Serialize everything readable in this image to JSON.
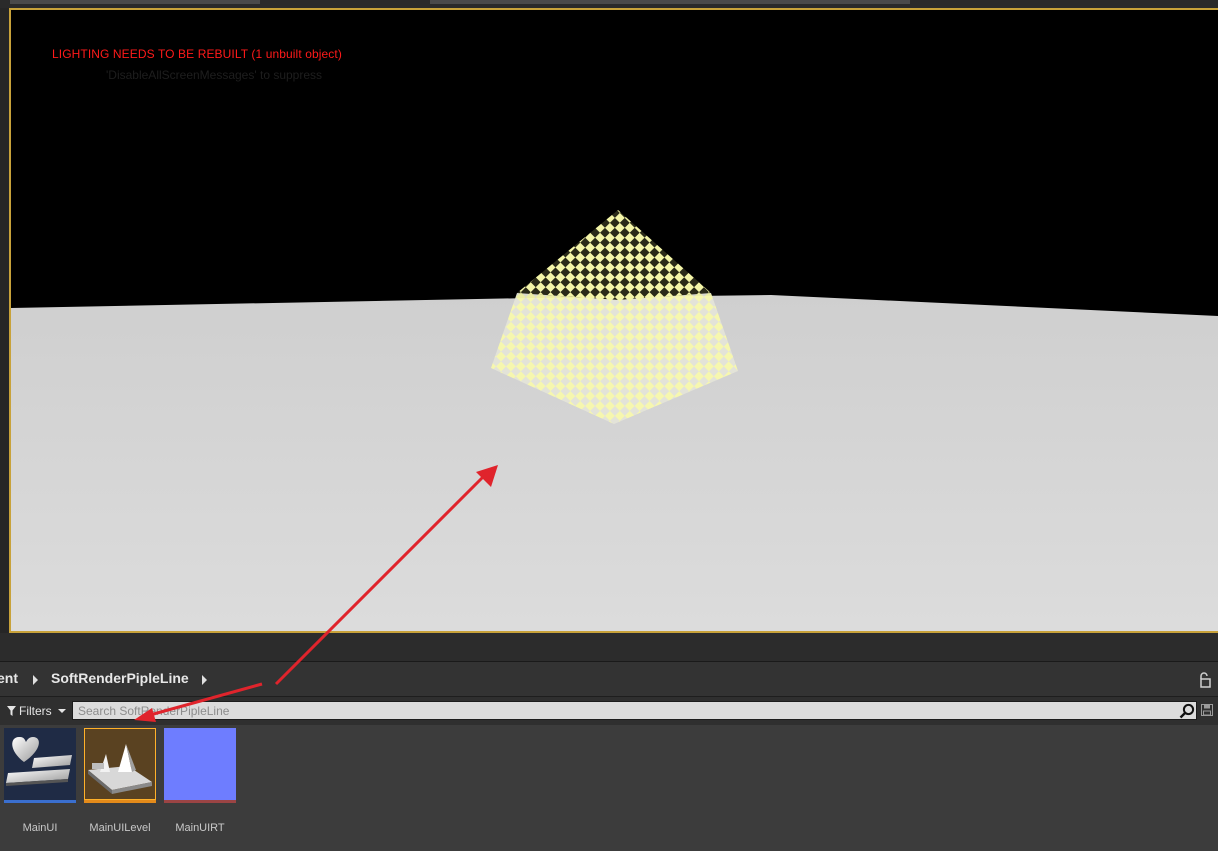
{
  "viewport": {
    "messages": {
      "lighting_warning": "LIGHTING NEEDS TO BE REBUILT (1 unbuilt object)",
      "suppress_hint": "'DisableAllScreenMessages' to suppress"
    }
  },
  "breadcrumb": {
    "items": [
      {
        "label": "ent"
      },
      {
        "label": "SoftRenderPipleLine"
      }
    ]
  },
  "toolbar": {
    "filters_label": "Filters",
    "search_placeholder": "Search SoftRenderPipleLine"
  },
  "assets": [
    {
      "label": "MainUI",
      "type": "widget-blueprint",
      "bar_color": "#3a6fcf"
    },
    {
      "label": "MainUILevel",
      "type": "level",
      "bar_color": "#e38a1a"
    },
    {
      "label": "MainUIRT",
      "type": "render-target",
      "bar_color": "#9b4444"
    }
  ],
  "colors": {
    "viewport_border": "#c8a23a",
    "warning_text": "#ff1a1a",
    "annotation_arrow": "#e0242c",
    "render_target_fill": "#6e7dff"
  }
}
